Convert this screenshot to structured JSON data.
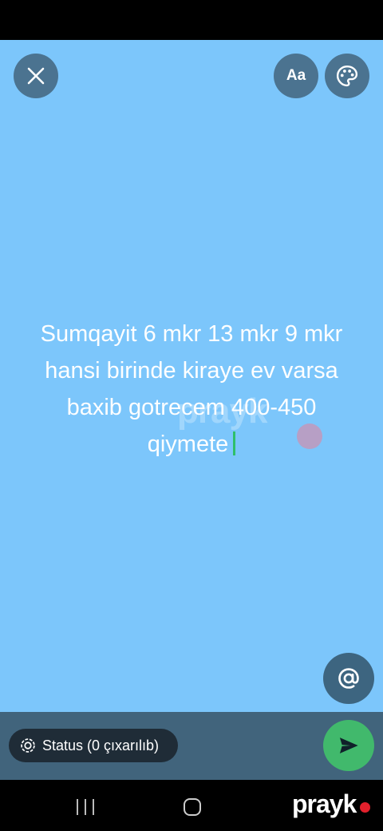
{
  "status_text": {
    "lines": [
      "Sumqayit 6 mkr 13 mkr 9 mkr",
      "hansi birinde kiraye  ev varsa",
      "baxib gotrecem 400-450",
      "qiymete"
    ]
  },
  "toolbar": {
    "font_label": "Aa"
  },
  "bottom": {
    "privacy_label": "Status (0 çıxarılıb)"
  },
  "branding": {
    "watermark": "prayk",
    "corner_brand": "prayk"
  },
  "colors": {
    "background": "#7cc6fb",
    "button": "#4b7390",
    "send": "#41b96c",
    "cursor": "#2fbf6a"
  },
  "icons": {
    "close": "close-icon",
    "palette": "palette-icon",
    "mention": "at-icon",
    "privacy": "privacy-icon",
    "send": "send-icon"
  }
}
